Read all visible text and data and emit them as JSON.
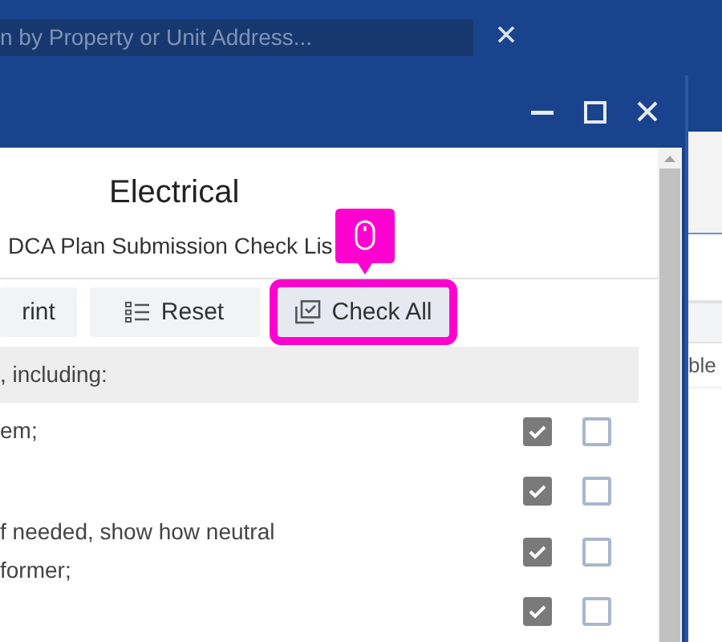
{
  "app": {
    "search": {
      "placeholder": "n by Property or Unit Address..."
    },
    "table_cell": "ble"
  },
  "dialog": {
    "title": "Electrical",
    "subtitle": "DCA Plan Submission Check Lis",
    "buttons": [
      {
        "label": "rint",
        "kind": "print",
        "highlighted": false
      },
      {
        "label": "Reset",
        "kind": "reset",
        "highlighted": false
      },
      {
        "label": "Check All",
        "kind": "check_all",
        "highlighted": true
      }
    ],
    "section": ", including:",
    "items": [
      {
        "text": "em;",
        "checks": [
          true,
          false
        ]
      },
      {
        "checks": [
          true,
          false
        ]
      },
      {
        "text": "f needed, show how neutral\nformer;",
        "checks": [
          true,
          false
        ]
      },
      {
        "checks": [
          true,
          false
        ]
      }
    ]
  }
}
